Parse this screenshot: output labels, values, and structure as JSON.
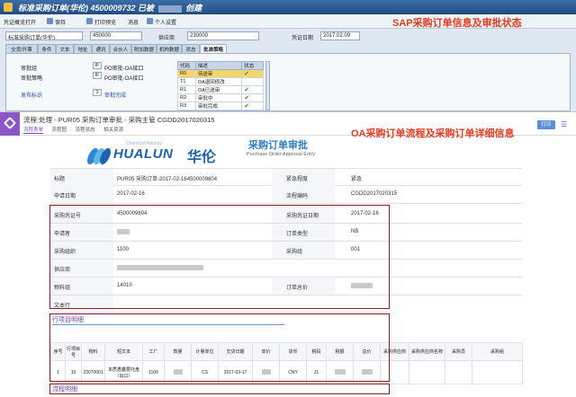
{
  "sap": {
    "window_title_prefix": "标准采购订单(华伦) 4500009732 已被",
    "window_title_suffix": "创建",
    "annotation": "SAP采购订单信息及审批状态",
    "toolbar": {
      "items": [
        "凭证概览打开",
        "保持",
        "打印预览",
        "消息",
        "个人设置"
      ]
    },
    "header": {
      "doc_type": "标准采购订单(华伦)",
      "po_number": "450000",
      "vendor_label": "供应商",
      "vendor_value": "230000",
      "doc_date_label": "凭证日期",
      "doc_date_value": "2017.02.09"
    },
    "tabs": [
      "交货/开票",
      "条件",
      "文本",
      "地址",
      "通讯",
      "合伙人",
      "附加数据",
      "机构数据",
      "状态",
      "批准策略"
    ],
    "panel": {
      "approval_group_label": "审批组",
      "approval_group_code": "IF",
      "approval_group_text": "PO审批-OA接口",
      "approval_strategy_label": "审批策略",
      "approval_strategy_code": "IF",
      "approval_strategy_text": "PO审批-OA接口",
      "release_indicator_label": "发布标识",
      "release_indicator_code": "3",
      "release_indicator_text": "审批完成"
    },
    "status_table": {
      "headers": [
        "代码",
        "描述",
        "状态"
      ],
      "rows": [
        {
          "code": "R0",
          "desc": "待送审",
          "done": true
        },
        {
          "code": "T1",
          "desc": "OA退回修改",
          "done": false
        },
        {
          "code": "R1",
          "desc": "OA已送审",
          "done": true
        },
        {
          "code": "R2",
          "desc": "审批中",
          "done": true
        },
        {
          "code": "R3",
          "desc": "审批完成",
          "done": true
        }
      ]
    }
  },
  "oa": {
    "window_title": "流程:处理 - PUR05 采购订单审批 - 采购主管 CGDD2017020315",
    "nav_tabs": [
      "流程表单",
      "流程图",
      "流程状态",
      "相关资源"
    ],
    "annotation": "OA采购订单流程及采购订单详细信息",
    "print_label": "打印",
    "brand": {
      "en_name": "HUALUN",
      "cn_name": "华伦",
      "en_sub": "Chemical Industry"
    },
    "form_title": "采购订单审批",
    "form_subtitle": "Purchase Order Approval Entry",
    "fields": {
      "title_label": "标题",
      "title_value": "PUR05 采购订单-2017-02-164500009804",
      "urgency_label": "紧急程度",
      "urgency_value": "紧急",
      "apply_date_label": "申请日期",
      "apply_date_value": "2017-02-16",
      "flow_code_label": "流程编码",
      "flow_code_value": "CGDD2017020315",
      "po_no_label": "采购凭证号",
      "po_no_value": "4500009804",
      "po_date_label": "采购凭证日期",
      "po_date_value": "2017-02-16",
      "applicant_label": "申请者",
      "order_type_label": "订单类型",
      "order_type_value": "NB",
      "purch_org_label": "采购组织",
      "purch_org_value": "1100",
      "purch_group_label": "采购组",
      "purch_group_value": "001",
      "vendor_label": "供应商",
      "material_group_label": "物料组",
      "material_group_value": "14010",
      "order_total_label": "订单总价",
      "doc_text_label": "文本行"
    },
    "line_items": {
      "section_title": "行项目明细",
      "headers": [
        "序号",
        "行项目号",
        "物料",
        "短文本",
        "工厂",
        "数量",
        "计量单位",
        "交货日期",
        "单价",
        "货币",
        "税码",
        "税额",
        "总价",
        "采购供应商",
        "采购供应商名称",
        "采购员",
        "采购组"
      ],
      "rows": [
        {
          "seq": "1",
          "item": "10",
          "material": "23070001",
          "short_text": "本质愚蠢要托盘（出口）",
          "plant": "1100",
          "qty": "",
          "unit": "CS",
          "delivery": "2017-03-17",
          "price": "",
          "currency": "CNY",
          "tax_code": "J1",
          "tax": "",
          "total": "",
          "vendor": "",
          "vendor_name": "",
          "buyer": "",
          "group": ""
        }
      ]
    },
    "next_section_title": "流程明细"
  }
}
